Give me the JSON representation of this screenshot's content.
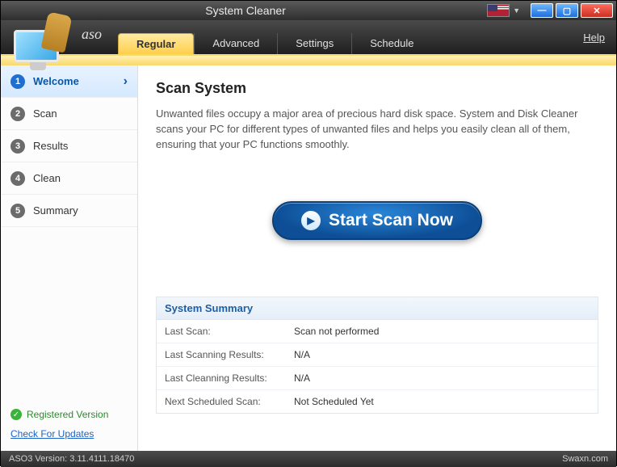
{
  "titlebar": {
    "title": "System Cleaner"
  },
  "brand": {
    "text": "aso"
  },
  "tabs": {
    "regular": "Regular",
    "advanced": "Advanced",
    "settings": "Settings",
    "schedule": "Schedule"
  },
  "help": "Help",
  "sidebar": {
    "steps": {
      "welcome": "Welcome",
      "scan": "Scan",
      "results": "Results",
      "clean": "Clean",
      "summary": "Summary"
    },
    "registered": "Registered Version",
    "updates": "Check For Updates"
  },
  "content": {
    "heading": "Scan System",
    "description": "Unwanted files occupy a major area of precious hard disk space. System and Disk Cleaner scans your PC for different types of unwanted files and helps you easily clean all of them, ensuring that your PC functions smoothly.",
    "scan_button": "Start Scan Now"
  },
  "summary": {
    "title": "System Summary",
    "rows": {
      "last_scan_k": "Last Scan:",
      "last_scan_v": "Scan not performed",
      "last_scanning_k": "Last Scanning Results:",
      "last_scanning_v": "N/A",
      "last_cleaning_k": "Last Cleanning Results:",
      "last_cleaning_v": "N/A",
      "next_sched_k": "Next Scheduled Scan:",
      "next_sched_v": "Not Scheduled Yet"
    }
  },
  "statusbar": {
    "version": "ASO3 Version: 3.11.4111.18470",
    "watermark": "Swaxn.com"
  }
}
